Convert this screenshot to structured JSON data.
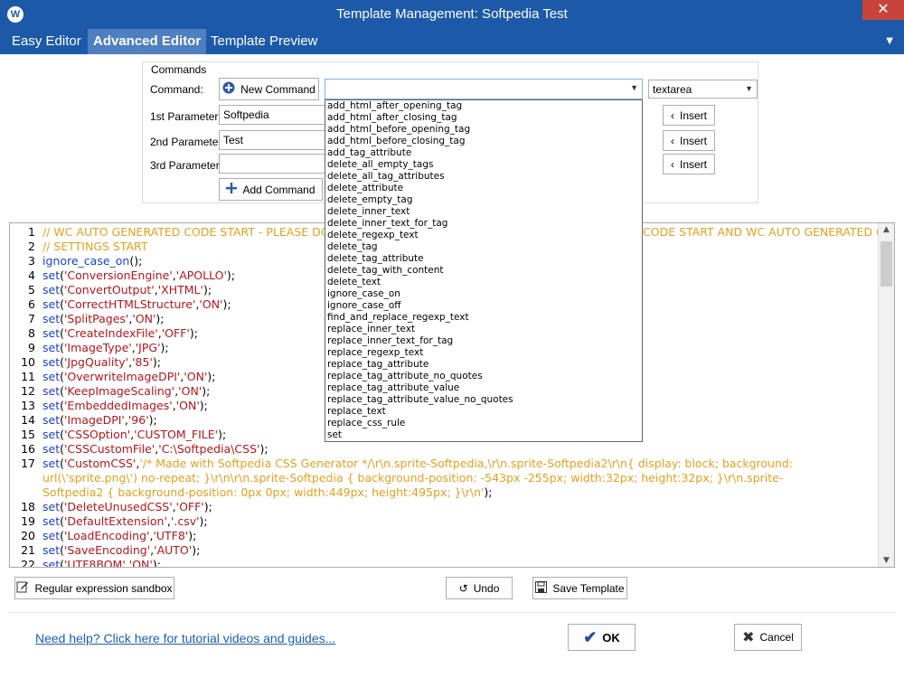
{
  "window": {
    "title": "Template Management: Softpedia Test",
    "close_glyph": "✕",
    "app_icon_letter": "W"
  },
  "tabs": [
    {
      "label": "Easy Editor",
      "active": false
    },
    {
      "label": "Advanced Editor",
      "active": true
    },
    {
      "label": "Template Preview",
      "active": false
    }
  ],
  "commands": {
    "group_label": "Commands",
    "command_label": "Command:",
    "param1_label": "1st Parameter:",
    "param2_label": "2nd Parameter:",
    "param3_label": "3rd Parameter:",
    "new_command_label": "New Command",
    "add_command_label": "Add Command",
    "param1_value": "Softpedia",
    "param2_value": "Test",
    "param3_value": "",
    "command_value": "",
    "type_value": "textarea",
    "insert_label": "Insert",
    "dropdown_options": [
      "add_html_after_opening_tag",
      "add_html_after_closing_tag",
      "add_html_before_opening_tag",
      "add_html_before_closing_tag",
      "add_tag_attribute",
      "delete_all_empty_tags",
      "delete_all_tag_attributes",
      "delete_attribute",
      "delete_empty_tag",
      "delete_inner_text",
      "delete_inner_text_for_tag",
      "delete_regexp_text",
      "delete_tag",
      "delete_tag_attribute",
      "delete_tag_with_content",
      "delete_text",
      "ignore_case_on",
      "ignore_case_off",
      "find_and_replace_regexp_text",
      "replace_inner_text",
      "replace_inner_text_for_tag",
      "replace_regexp_text",
      "replace_tag_attribute",
      "replace_tag_attribute_no_quotes",
      "replace_tag_attribute_value",
      "replace_tag_attribute_value_no_quotes",
      "replace_text",
      "replace_css_rule",
      "set"
    ]
  },
  "editor": {
    "lines": [
      {
        "n": "1",
        "parts": [
          [
            "c-com",
            "// WC AUTO GENERATED CODE START - PLEASE DO NOT EDIT ANYTHING BETWEEN WC AUTO GENERATED CODE START AND WC AUTO GENERATED CODE END"
          ]
        ]
      },
      {
        "n": "2",
        "parts": [
          [
            "c-com",
            "// SETTINGS START"
          ]
        ]
      },
      {
        "n": "3",
        "parts": [
          [
            "c-fn",
            "ignore_case_on"
          ],
          [
            "c-op",
            "();"
          ]
        ]
      },
      {
        "n": "4",
        "parts": [
          [
            "c-fn",
            "set"
          ],
          [
            "c-op",
            "("
          ],
          [
            "c-str",
            "'ConversionEngine'"
          ],
          [
            "c-op",
            ","
          ],
          [
            "c-str",
            "'APOLLO'"
          ],
          [
            "c-op",
            ");"
          ]
        ]
      },
      {
        "n": "5",
        "parts": [
          [
            "c-fn",
            "set"
          ],
          [
            "c-op",
            "("
          ],
          [
            "c-str",
            "'ConvertOutput'"
          ],
          [
            "c-op",
            ","
          ],
          [
            "c-str",
            "'XHTML'"
          ],
          [
            "c-op",
            ");"
          ]
        ]
      },
      {
        "n": "6",
        "parts": [
          [
            "c-fn",
            "set"
          ],
          [
            "c-op",
            "("
          ],
          [
            "c-str",
            "'CorrectHTMLStructure'"
          ],
          [
            "c-op",
            ","
          ],
          [
            "c-str",
            "'ON'"
          ],
          [
            "c-op",
            ");"
          ]
        ]
      },
      {
        "n": "7",
        "parts": [
          [
            "c-fn",
            "set"
          ],
          [
            "c-op",
            "("
          ],
          [
            "c-str",
            "'SplitPages'"
          ],
          [
            "c-op",
            ","
          ],
          [
            "c-str",
            "'ON'"
          ],
          [
            "c-op",
            ");"
          ]
        ]
      },
      {
        "n": "8",
        "parts": [
          [
            "c-fn",
            "set"
          ],
          [
            "c-op",
            "("
          ],
          [
            "c-str",
            "'CreateIndexFile'"
          ],
          [
            "c-op",
            ","
          ],
          [
            "c-str",
            "'OFF'"
          ],
          [
            "c-op",
            ");"
          ]
        ]
      },
      {
        "n": "9",
        "parts": [
          [
            "c-fn",
            "set"
          ],
          [
            "c-op",
            "("
          ],
          [
            "c-str",
            "'ImageType'"
          ],
          [
            "c-op",
            ","
          ],
          [
            "c-str",
            "'JPG'"
          ],
          [
            "c-op",
            ");"
          ]
        ]
      },
      {
        "n": "10",
        "parts": [
          [
            "c-fn",
            "set"
          ],
          [
            "c-op",
            "("
          ],
          [
            "c-str",
            "'JpgQuality'"
          ],
          [
            "c-op",
            ","
          ],
          [
            "c-str",
            "'85'"
          ],
          [
            "c-op",
            ");"
          ]
        ]
      },
      {
        "n": "11",
        "parts": [
          [
            "c-fn",
            "set"
          ],
          [
            "c-op",
            "("
          ],
          [
            "c-str",
            "'OverwriteImageDPI'"
          ],
          [
            "c-op",
            ","
          ],
          [
            "c-str",
            "'ON'"
          ],
          [
            "c-op",
            ");"
          ]
        ]
      },
      {
        "n": "12",
        "parts": [
          [
            "c-fn",
            "set"
          ],
          [
            "c-op",
            "("
          ],
          [
            "c-str",
            "'KeepImageScaling'"
          ],
          [
            "c-op",
            ","
          ],
          [
            "c-str",
            "'ON'"
          ],
          [
            "c-op",
            ");"
          ]
        ]
      },
      {
        "n": "13",
        "parts": [
          [
            "c-fn",
            "set"
          ],
          [
            "c-op",
            "("
          ],
          [
            "c-str",
            "'EmbeddedImages'"
          ],
          [
            "c-op",
            ","
          ],
          [
            "c-str",
            "'ON'"
          ],
          [
            "c-op",
            ");"
          ]
        ]
      },
      {
        "n": "14",
        "parts": [
          [
            "c-fn",
            "set"
          ],
          [
            "c-op",
            "("
          ],
          [
            "c-str",
            "'ImageDPI'"
          ],
          [
            "c-op",
            ","
          ],
          [
            "c-str",
            "'96'"
          ],
          [
            "c-op",
            ");"
          ]
        ]
      },
      {
        "n": "15",
        "parts": [
          [
            "c-fn",
            "set"
          ],
          [
            "c-op",
            "("
          ],
          [
            "c-str",
            "'CSSOption'"
          ],
          [
            "c-op",
            ","
          ],
          [
            "c-str",
            "'CUSTOM_FILE'"
          ],
          [
            "c-op",
            ");"
          ]
        ]
      },
      {
        "n": "16",
        "parts": [
          [
            "c-fn",
            "set"
          ],
          [
            "c-op",
            "("
          ],
          [
            "c-str",
            "'CSSCustomFile'"
          ],
          [
            "c-op",
            ","
          ],
          [
            "c-str",
            "'C:\\Softpedia\\CSS'"
          ],
          [
            "c-op",
            ");"
          ]
        ]
      },
      {
        "n": "17",
        "parts": [
          [
            "c-fn",
            "set"
          ],
          [
            "c-op",
            "("
          ],
          [
            "c-str",
            "'CustomCSS'"
          ],
          [
            "c-op",
            ","
          ],
          [
            "c-com",
            "'/* Made with Softpedia CSS Generator */\\r\\n.sprite-Softpedia,\\r\\n.sprite-Softpedia2\\r\\n{ display: block; background:"
          ]
        ]
      },
      {
        "n": "",
        "parts": [
          [
            "c-com",
            "url(\\'sprite.png\\') no-repeat; }\\r\\n\\r\\n.sprite-Softpedia { background-position: -543px -255px; width:32px; height:32px; }\\r\\n.sprite-"
          ]
        ]
      },
      {
        "n": "",
        "parts": [
          [
            "c-com",
            "Softpedia2 { background-position: 0px 0px; width:449px; height:495px; }\\r\\n'"
          ],
          [
            "c-op",
            ");"
          ]
        ]
      },
      {
        "n": "18",
        "parts": [
          [
            "c-fn",
            "set"
          ],
          [
            "c-op",
            "("
          ],
          [
            "c-str",
            "'DeleteUnusedCSS'"
          ],
          [
            "c-op",
            ","
          ],
          [
            "c-str",
            "'OFF'"
          ],
          [
            "c-op",
            ");"
          ]
        ]
      },
      {
        "n": "19",
        "parts": [
          [
            "c-fn",
            "set"
          ],
          [
            "c-op",
            "("
          ],
          [
            "c-str",
            "'DefaultExtension'"
          ],
          [
            "c-op",
            ","
          ],
          [
            "c-str",
            "'.csv'"
          ],
          [
            "c-op",
            ");"
          ]
        ]
      },
      {
        "n": "20",
        "parts": [
          [
            "c-fn",
            "set"
          ],
          [
            "c-op",
            "("
          ],
          [
            "c-str",
            "'LoadEncoding'"
          ],
          [
            "c-op",
            ","
          ],
          [
            "c-str",
            "'UTF8'"
          ],
          [
            "c-op",
            ");"
          ]
        ]
      },
      {
        "n": "21",
        "parts": [
          [
            "c-fn",
            "set"
          ],
          [
            "c-op",
            "("
          ],
          [
            "c-str",
            "'SaveEncoding'"
          ],
          [
            "c-op",
            ","
          ],
          [
            "c-str",
            "'AUTO'"
          ],
          [
            "c-op",
            ");"
          ]
        ]
      },
      {
        "n": "22",
        "parts": [
          [
            "c-fn",
            "set"
          ],
          [
            "c-op",
            "("
          ],
          [
            "c-str",
            "'UTF8BOM'"
          ],
          [
            "c-op",
            ","
          ],
          [
            "c-str",
            "'ON'"
          ],
          [
            "c-op",
            ");"
          ]
        ]
      }
    ]
  },
  "bottom": {
    "regex_sandbox_label": "Regular expression sandbox",
    "undo_label": "Undo",
    "save_template_label": "Save Template",
    "help_link": "Need help? Click here for tutorial videos and guides...",
    "ok_label": "OK",
    "cancel_label": "Cancel"
  }
}
